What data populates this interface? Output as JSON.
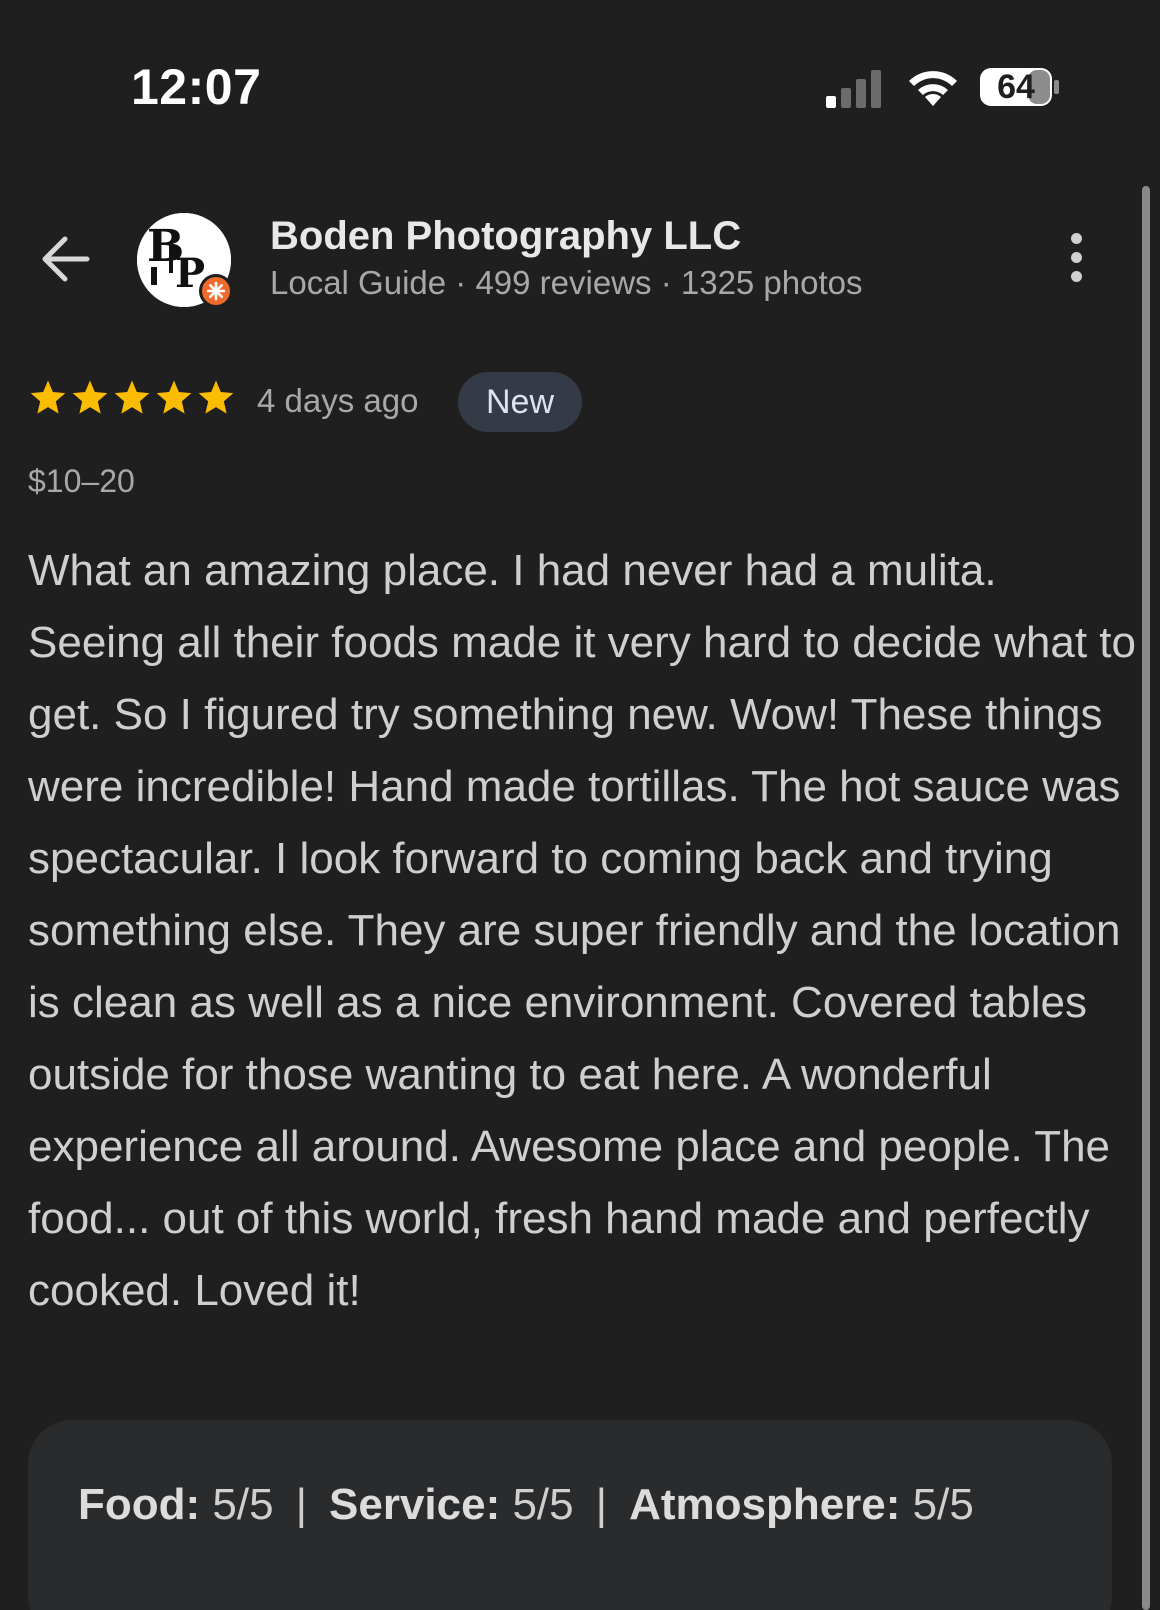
{
  "status_bar": {
    "time": "12:07",
    "battery": "64",
    "signal_icon": "cellular-signal-icon",
    "wifi_icon": "wifi-icon"
  },
  "header": {
    "reviewer_name": "Boden Photography LLC",
    "reviewer_meta": "Local Guide · 499 reviews · 1325 photos",
    "avatar_initials": "BP",
    "badge_color": "#ee6a2c"
  },
  "review": {
    "rating": 5,
    "max_rating": 5,
    "star_color": "#fbbc04",
    "date": "4 days ago",
    "badge": "New",
    "price": "$10–20",
    "text": "What an amazing place. I had never had a mulita. Seeing all their foods made it very hard to decide what to get. So I figured try something new. Wow! These things were incredible! Hand made tortillas. The hot sauce was spectacular. I look forward to coming back and trying something else. They are super friendly and the location is clean as well as a nice environment. Covered tables outside for those wanting to eat here. A wonderful experience all around. Awesome place and people. The food... out of this world, fresh hand made and perfectly cooked. Loved it!"
  },
  "attributes": [
    {
      "label": "Food:",
      "value": " 5/5"
    },
    {
      "label": "Service:",
      "value": " 5/5"
    },
    {
      "label": "Atmosphere:",
      "value": " 5/5"
    }
  ],
  "separator": "|"
}
